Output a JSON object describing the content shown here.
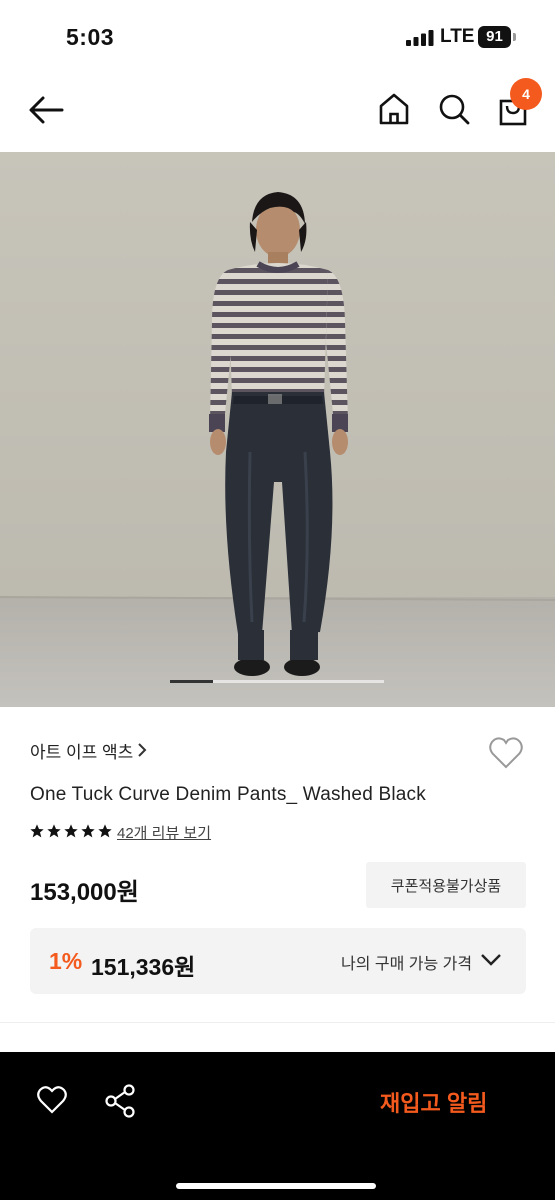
{
  "status_bar": {
    "time": "5:03",
    "network": "LTE",
    "battery": "91"
  },
  "header": {
    "cart_count": "4"
  },
  "product": {
    "brand": "아트 이프 액츠",
    "title": "One Tuck Curve Denim Pants_ Washed Black",
    "rating": 5,
    "review_link": "42개 리뷰 보기",
    "price": "153,000원",
    "coupon_label": "쿠폰적용불가상품",
    "benefit": {
      "percent": "1%",
      "price": "151,336원",
      "label": "나의 구매 가능 가격"
    },
    "carousel": {
      "current": 1,
      "total": 5
    }
  },
  "bottom_bar": {
    "restock_label": "재입고 알림"
  },
  "colors": {
    "accent": "#f45a1d",
    "bottom_bar": "#000000"
  }
}
